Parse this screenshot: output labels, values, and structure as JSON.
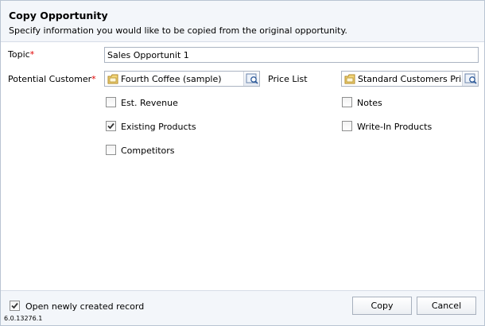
{
  "header": {
    "title": "Copy Opportunity",
    "subtitle": "Specify information you would like to be copied from the original opportunity."
  },
  "fields": {
    "topic": {
      "label": "Topic",
      "required_mark": "*",
      "value": "Sales Opportunit 1"
    },
    "potential_customer": {
      "label": "Potential Customer",
      "required_mark": "*",
      "value": "Fourth Coffee (sample)",
      "icon": "record-icon"
    },
    "price_list": {
      "label": "Price List",
      "value": "Standard Customers Price List",
      "icon": "record-icon"
    }
  },
  "options": {
    "est_revenue": {
      "label": "Est. Revenue",
      "checked": false
    },
    "existing_products": {
      "label": "Existing Products",
      "checked": true
    },
    "competitors": {
      "label": "Competitors",
      "checked": false
    },
    "notes": {
      "label": "Notes",
      "checked": false
    },
    "write_in_products": {
      "label": "Write-In Products",
      "checked": false
    }
  },
  "footer": {
    "open_record": {
      "label": "Open newly created record",
      "checked": true
    },
    "copy_label": "Copy",
    "cancel_label": "Cancel",
    "version": "6.0.13276.1"
  },
  "colors": {
    "required": "#e00000",
    "header_bg": "#f3f6fa",
    "check_mark": "#333333"
  }
}
